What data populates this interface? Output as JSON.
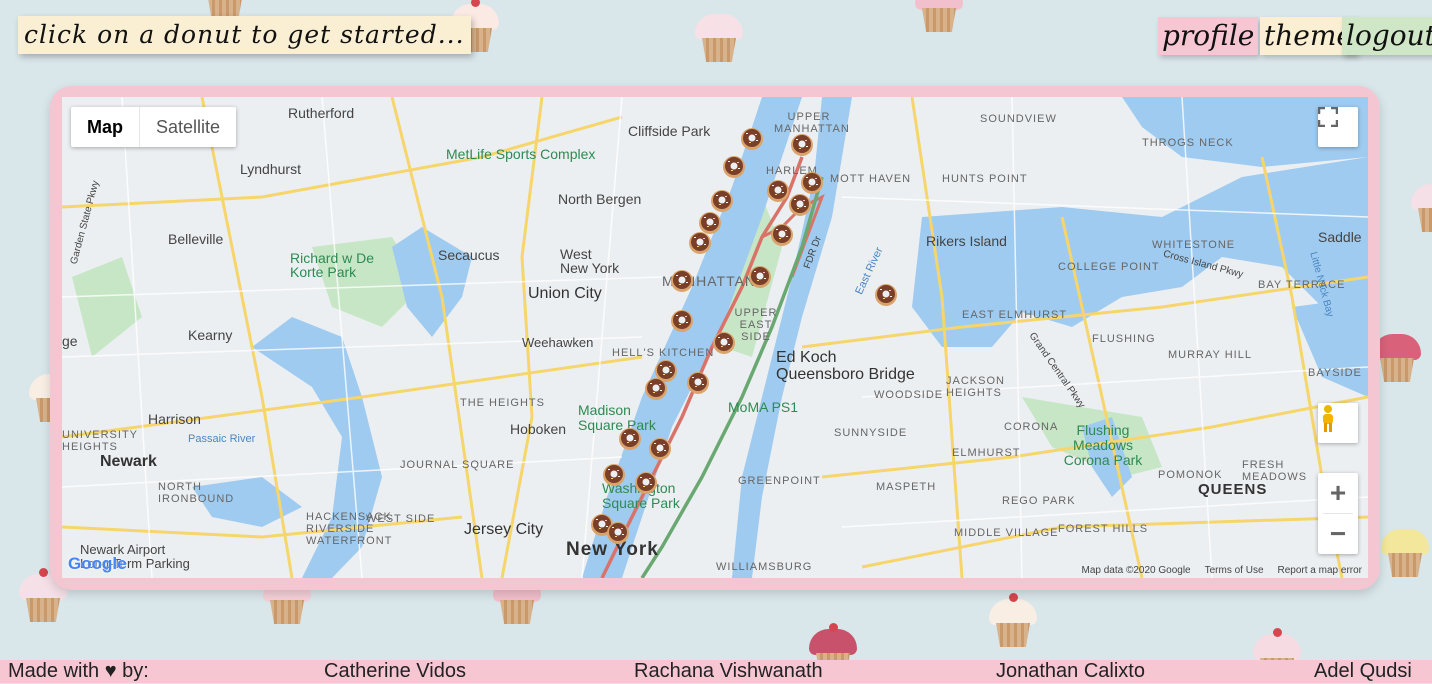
{
  "header": {
    "prompt": "click on a donut to get started...",
    "nav": [
      "profile",
      "theme",
      "logout"
    ]
  },
  "map": {
    "type_buttons": [
      "Map",
      "Satellite"
    ],
    "selected_type": "Map",
    "labels": {
      "rutherford": "Rutherford",
      "lyndhurst": "Lyndhurst",
      "cliffside_park": "Cliffside Park",
      "metlife": "MetLife Sports Complex",
      "north_bergen": "North Bergen",
      "upper_manhattan": "UPPER MANHATTAN",
      "harlem": "HARLEM",
      "mott_haven": "MOTT HAVEN",
      "hunts_point": "HUNTS POINT",
      "soundview": "SOUNDVIEW",
      "throgs_neck": "THROGS NECK",
      "belleville": "Belleville",
      "richard_korte": "Richard w De Korte Park",
      "secaucus": "Secaucus",
      "west_new_york": "West New York",
      "union_city": "Union City",
      "manhattan": "MANHATTAN",
      "rikers": "Rikers Island",
      "whitestone": "WHITESTONE",
      "college_point": "COLLEGE POINT",
      "bay_terrace": "BAY TERRACE",
      "saddle": "Saddle",
      "kearny": "Kearny",
      "weehawken": "Weehawken",
      "hells_kitchen": "HELL'S KITCHEN",
      "upper_east_side": "UPPER EAST SIDE",
      "east_elmhurst": "EAST ELMHURST",
      "flushing": "FLUSHING",
      "murray_hill": "MURRAY HILL",
      "bayside": "BAYSIDE",
      "ed_koch": "Ed Koch Queensboro Bridge",
      "jackson_heights": "JACKSON HEIGHTS",
      "harrison": "Harrison",
      "the_heights": "THE HEIGHTS",
      "madison_square": "Madison Square Park",
      "moma": "MoMA PS1",
      "hoboken": "Hoboken",
      "woodside": "WOODSIDE",
      "sunnyside": "SUNNYSIDE",
      "corona": "CORONA",
      "flushing_meadows": "Flushing Meadows Corona Park",
      "university_heights": "UNIVERSITY HEIGHTS",
      "newark": "Newark",
      "journal_square": "JOURNAL SQUARE",
      "washington_square": "Washington Square Park",
      "greenpoint": "GREENPOINT",
      "maspeth": "MASPETH",
      "elmhurst": "ELMHURST",
      "fresh_meadows": "FRESH MEADOWS",
      "queens": "QUEENS",
      "north_ironbound": "NORTH IRONBOUND",
      "pomonok": "POMONOK",
      "hackensack_waterfront": "HACKENSACK RIVERSIDE WATERFRONT",
      "west_side": "WEST SIDE",
      "jersey_city": "Jersey City",
      "rego_park": "REGO PARK",
      "middle_village": "MIDDLE VILLAGE",
      "forest_hills": "FOREST HILLS",
      "newark_airport": "Newark Airport Long-Term Parking",
      "new_york": "New York",
      "williamsburg": "WILLIAMSBURG",
      "passaic_river": "Passaic River",
      "east_river": "East River",
      "ge": "ge",
      "garden_state": "Garden State Pkwy",
      "cross_island": "Cross Island Pkwy",
      "grand_central": "Grand Central Pkwy",
      "little_neck": "Little Neck Bay",
      "fdr": "FDR Dr"
    },
    "attribution": {
      "data": "Map data ©2020 Google",
      "terms": "Terms of Use",
      "report": "Report a map error"
    },
    "google_logo": "Google",
    "zoom_in": "+",
    "zoom_out": "−"
  },
  "colors": {
    "background": "#d9e6ea",
    "frame": "#f4c6d2",
    "route_red": "#d9736a",
    "route_green": "#6aa872",
    "water": "#9fcbf0"
  },
  "footer": {
    "made_with": "Made with ♥ by:",
    "authors": [
      "Catherine Vidos",
      "Rachana Vishwanath",
      "Jonathan Calixto",
      "Adel Qudsi"
    ]
  }
}
